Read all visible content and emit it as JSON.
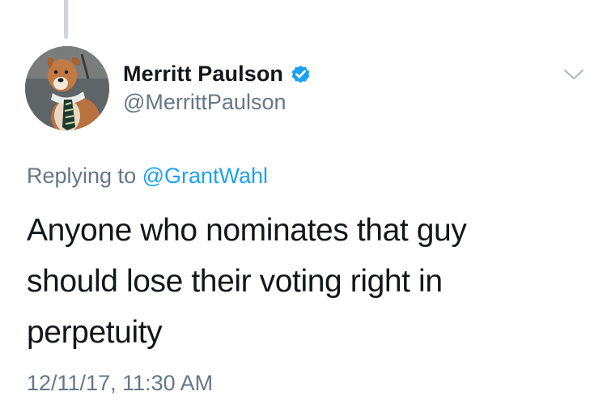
{
  "tweet": {
    "author": {
      "display_name": "Merritt Paulson",
      "handle": "@MerrittPaulson",
      "verified": true
    },
    "reply": {
      "prefix": "Replying to",
      "mention": "@GrantWahl"
    },
    "text_lines": [
      "Anyone who nominates that guy",
      "should lose their voting right in",
      "perpetuity"
    ],
    "timestamp": "12/11/17, 11:30 AM"
  },
  "icons": {
    "verified": "verified-badge-icon",
    "more": "chevron-down-icon"
  },
  "colors": {
    "verified_blue": "#1da1f2",
    "link_blue": "#1da1f2",
    "secondary_text": "#657786",
    "primary_text": "#14171a",
    "thread_line": "#ccd6dd"
  }
}
